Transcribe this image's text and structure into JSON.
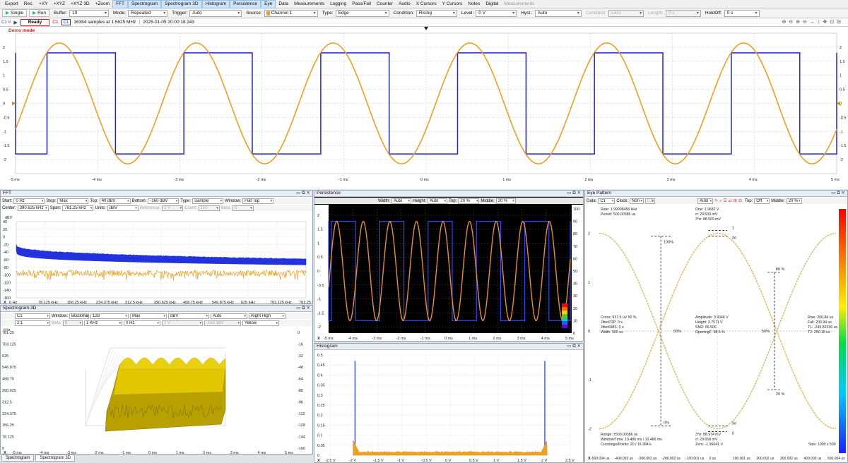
{
  "menu": {
    "items": [
      "Export",
      "Rec.",
      "+XY",
      "+XYZ",
      "+XYZ 3D",
      "+Zoom",
      "FFT",
      "Spectrogram",
      "Spectrogram 3D",
      "Histogram",
      "Persistence",
      "Eye",
      "Data",
      "Measurements",
      "Logging",
      "Pass/Fail",
      "Counter",
      "Audio",
      "X Cursors",
      "Y Cursors",
      "Notes",
      "Digital",
      "Measurements"
    ]
  },
  "toolbar": {
    "single_label": "Single",
    "run_label": "Run",
    "buffer_label": "Buffer:",
    "buffer_value": "10",
    "mode_label": "Mode:",
    "mode_value": "Repeated",
    "trigger_label": "Trigger:",
    "trigger_value": "Auto",
    "source_label": "Source:",
    "source_value": "Channel 1",
    "type_label": "Type:",
    "type_value": "Edge",
    "condition_label": "Condition:",
    "condition_value": "Rising",
    "level_label": "Level:",
    "level_value": "0 V",
    "hyst_label": "Hyst.:",
    "hyst_value": "Auto",
    "condition2_label": "Condition:",
    "condition2_value": "Less",
    "length_label": "Length:",
    "length_value": "0 s",
    "holdoff_label": "HoldOff:",
    "holdoff_value": "0 s"
  },
  "status": {
    "ready_label": "Ready",
    "channel_badge": "C1",
    "samples_text": "16384 samples at 1.5625 MHz",
    "timestamp_text": "2025-01-05 20:00:18.343",
    "scale_label": "C1 V"
  },
  "scope": {
    "demo_label": "Demo mode",
    "y_ticks": [
      "2",
      "1.5",
      "1",
      "0.5",
      "0",
      "-0.5",
      "-1",
      "-1.5",
      "-2"
    ],
    "x_ticks": [
      "-5 ms",
      "-4 ms",
      "-3 ms",
      "-2 ms",
      "-1 ms",
      "0 ms",
      "1 ms",
      "2 ms",
      "3 ms",
      "4 ms",
      "5 ms"
    ],
    "colors": {
      "square": "#2222dd",
      "sine": "#f0a020",
      "grid": "#c9c9c9"
    }
  },
  "fft": {
    "title": "FFT",
    "start_label": "Start:",
    "start_value": "0 Hz",
    "stop_label": "Stop:",
    "stop_value": "Max",
    "top_label": "Top:",
    "top_value": "40 dBV",
    "bottom_label": "Bottom:",
    "bottom_value": "-160 dBV",
    "type_label": "Type:",
    "type_value": "Sample",
    "window_label": "Window:",
    "window_value": "Flat Top",
    "center_label": "Center:",
    "center_value": "390.625 kHz",
    "span_label": "Span:",
    "span_value": "781.25 kHz",
    "units_label": "Units:",
    "units_value": "dBV",
    "reference_label": "Reference:",
    "reference_value": "1 V",
    "count_label": "Count:",
    "count_value": "100",
    "beta_label": "Beta:",
    "beta_value": "8",
    "unit_label": "dBV",
    "y_ticks": [
      "40",
      "20",
      "0",
      "-20",
      "-40",
      "-60",
      "-80",
      "-100",
      "-120",
      "-140",
      "-160"
    ],
    "x_ticks": [
      "0 Hz",
      "78.125 kHz",
      "156.25 kHz",
      "234.375 kHz",
      "312.5 kHz",
      "390.625 kHz",
      "468.75 kHz",
      "546.875 kHz",
      "625 kHz",
      "703.125 kHz",
      "781.25 kHz"
    ]
  },
  "spec3d": {
    "title": "Spectrogram 3D",
    "source_value": "C1",
    "window_label": "Window:",
    "window_value": "Blackman",
    "fft_value": "128",
    "max_value": "Max",
    "unit_value": "dBV",
    "auto_value": "Auto",
    "view_value": "Right High",
    "ratio_value": "2:1",
    "beta_label": "Beta:",
    "beta_value": "8",
    "hz_value": "1 KHz",
    "zero_value": "0 Hz",
    "volt_value": "1 V",
    "db_value": "-160 dBV",
    "color_value": "Yellow",
    "unit_label": "kHz",
    "y_ticks": [
      "781.25",
      "703.125",
      "625",
      "546.875",
      "468.75",
      "390.625",
      "312.5",
      "234.375",
      "156.25",
      "78.125",
      "0"
    ],
    "right_ticks": [
      "0",
      "-16",
      "-32",
      "-48",
      "-64",
      "-80",
      "-96",
      "-112",
      "-128",
      "-144",
      "-160"
    ],
    "x_ticks": [
      "-5 ms",
      "-4 ms",
      "-3 ms",
      "-2 ms",
      "-1 ms",
      "0 ms",
      "1 ms",
      "2 ms",
      "3 ms",
      "4 ms",
      "5 ms"
    ]
  },
  "persistence": {
    "title": "Persistence",
    "width_label": "Width:",
    "width_value": "Auto",
    "height_label": "Height:",
    "height_value": "Auto",
    "top_label": "Top:",
    "top_value": "20 %",
    "middle_label": "Middle:",
    "middle_value": "20 %",
    "y_ticks": [
      "2",
      "1.5",
      "1",
      "0.5",
      "0",
      "-0.5",
      "-1",
      "-1.5",
      "-2"
    ],
    "right_ticks": [
      "100",
      "90",
      "80",
      "70",
      "60",
      "50",
      "40",
      "30",
      "20",
      "10",
      "0"
    ],
    "x_ticks": [
      "-5 ms",
      "-4 ms",
      "-3 ms",
      "-2 ms",
      "-1 ms",
      "0 ms",
      "1 ms",
      "2 ms",
      "3 ms",
      "4 ms",
      "5 ms"
    ]
  },
  "histogram": {
    "title": "Histogram",
    "y_ticks": [
      "0.5",
      "0.45",
      "0.4",
      "0.35",
      "0.3",
      "0.25",
      "0.2",
      "0.15",
      "0.1",
      "0.05",
      "0"
    ],
    "x_ticks": [
      "-2.5 V",
      "-2 V",
      "-1.5 V",
      "-1 V",
      "-0.5 V",
      "0 V",
      "0.5 V",
      "1 V",
      "1.5 V",
      "2 V",
      "2.5 V"
    ]
  },
  "eye": {
    "title": "Eye Pattern",
    "data_label": "Data:",
    "data_value": "C1",
    "clock_label": "Clock:",
    "clock_value": "Non",
    "clock_extra": "0.0",
    "rate_value": "Auto",
    "top_label": "Top:",
    "top_value": "Off",
    "middle_label": "Middle:",
    "middle_value": "20 %",
    "rate_text": "Rate: 1.99998456 kHz",
    "period_text": "Period: 500.00386 us",
    "one_text": "One: 1.9682 V",
    "one_sigma_text": "σ: 29.503 mV",
    "one_3sigma_text": "3*σ: 88.509 mV",
    "cross_text": "Cross: 937.5 uV  50 %",
    "jitter_pp_text": "JitterP2P: 0 s",
    "jitter_rms_text": "JitterRMS: 0 s",
    "width_text": "Width: 500 us",
    "amplitude_text": "Amplitude: 3.9346 V",
    "height_text": "Height: 3.7571 V",
    "snr_text": "SNR: 66.506",
    "opening_text": "OpeningF: 98.5 %",
    "rise_text": "Rise: 200.84 us",
    "fall_text": "Fall: 200.94 us",
    "t1_text": "T1: -249.82336 us",
    "t2_text": "T2: 250.18 us",
    "range_text": "Range: ±500.00386 us",
    "window_time_text": "Window/Time: 10.486 ms / 10.486 ms",
    "crossings_text": "Crossings/Points: 20  / 16.384 k",
    "zero_3sigma_text": "3*σ: 88.974 mV",
    "zero_sigma_text": "σ: 29.658 mV",
    "zero_text": "Zero: -1.96641 V",
    "size_text": "Size:  1000 x 500",
    "pct_100": "100%",
    "pct_80": "80 %",
    "pct_50a": "50%",
    "pct_50b": "50%",
    "pct_20": "20 %",
    "pct_0": "0%",
    "label_1": "1",
    "label_3s_top": "3σ",
    "label_0": "0",
    "label_3s_bot": "3σ",
    "y_ticks": [
      "2",
      "1",
      "0",
      "-1",
      "-2"
    ],
    "x_ticks": [
      "-500.004 us",
      "-400.003 us",
      "-300.002 us",
      "-200.002 us",
      "-100.001 us",
      "0 us",
      "100.001 us",
      "200.002 us",
      "300.002 us",
      "400.003 us",
      "500.004 us"
    ]
  },
  "tabs": {
    "spectrogram_label": "Spectrogram",
    "spectrogram3d_label": "Spectrogram 3D"
  }
}
